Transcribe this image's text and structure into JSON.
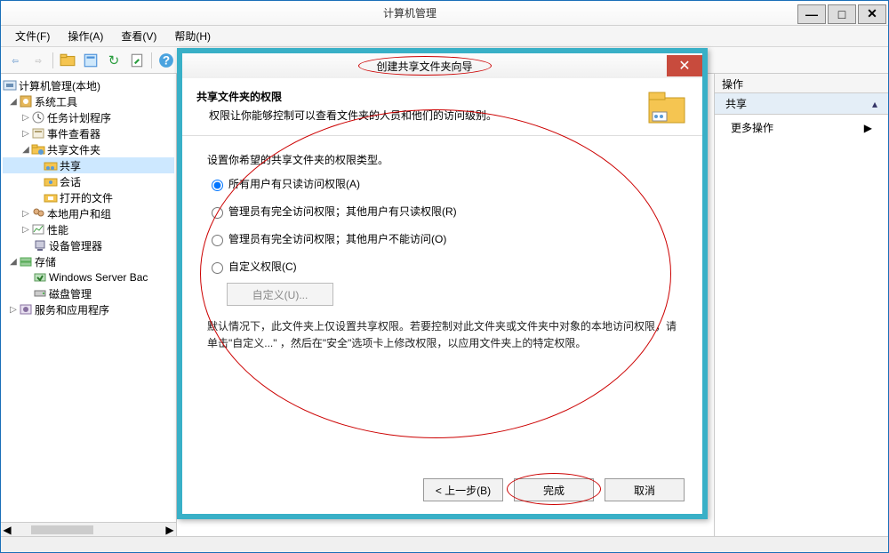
{
  "window": {
    "title": "计算机管理",
    "controls": {
      "min": "—",
      "max": "□",
      "close": "✕"
    }
  },
  "menu": {
    "file": "文件(F)",
    "action": "操作(A)",
    "view": "查看(V)",
    "help": "帮助(H)"
  },
  "tree": {
    "root": "计算机管理(本地)",
    "systemTools": "系统工具",
    "taskScheduler": "任务计划程序",
    "eventViewer": "事件查看器",
    "sharedFolders": "共享文件夹",
    "shares": "共享",
    "sessions": "会话",
    "openFiles": "打开的文件",
    "localUsers": "本地用户和组",
    "performance": "性能",
    "deviceManager": "设备管理器",
    "storage": "存储",
    "wsb": "Windows Server Bac",
    "diskMgmt": "磁盘管理",
    "services": "服务和应用程序"
  },
  "rightPane": {
    "header": "操作",
    "section": "共享",
    "more": "更多操作"
  },
  "dialog": {
    "title": "创建共享文件夹向导",
    "head": {
      "title": "共享文件夹的权限",
      "subtitle": "权限让你能够控制可以查看文件夹的人员和他们的访问级别。"
    },
    "prompt": "设置你希望的共享文件夹的权限类型。",
    "radios": {
      "r1": "所有用户有只读访问权限(A)",
      "r2": "管理员有完全访问权限；其他用户有只读权限(R)",
      "r3": "管理员有完全访问权限；其他用户不能访问(O)",
      "r4": "自定义权限(C)"
    },
    "customBtn": "自定义(U)...",
    "note": "默认情况下，此文件夹上仅设置共享权限。若要控制对此文件夹或文件夹中对象的本地访问权限，请单击\"自定义...\" ，然后在\"安全\"选项卡上修改权限，以应用文件夹上的特定权限。",
    "buttons": {
      "back": "< 上一步(B)",
      "finish": "完成",
      "cancel": "取消"
    }
  }
}
